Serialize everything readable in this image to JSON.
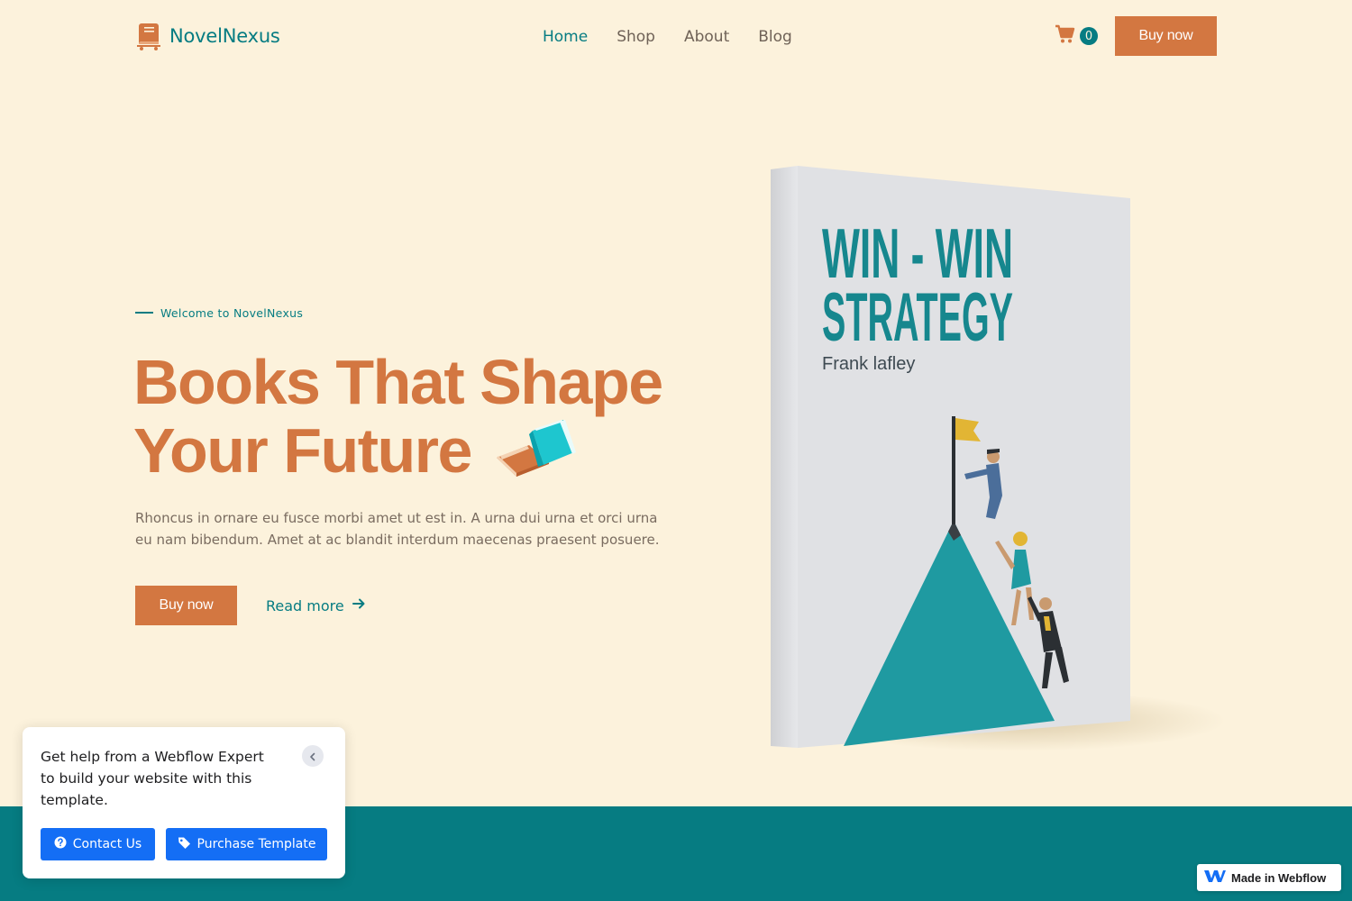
{
  "brand": {
    "name": "NovelNexus"
  },
  "nav": {
    "items": [
      {
        "label": "Home",
        "active": true
      },
      {
        "label": "Shop",
        "active": false
      },
      {
        "label": "About",
        "active": false
      },
      {
        "label": "Blog",
        "active": false
      }
    ],
    "cart_count": "0",
    "buy_label": "Buy now"
  },
  "hero": {
    "eyebrow": "Welcome to NovelNexus",
    "title_line1": "Books That Shape",
    "title_line2": "Your Future",
    "description": "Rhoncus in ornare eu fusce morbi amet ut est in. A urna dui urna et orci urna eu nam bibendum. Amet at ac blandit interdum maecenas praesent posuere.",
    "buy_label": "Buy now",
    "read_more_label": "Read more"
  },
  "book": {
    "title_line1": "WIN - WIN",
    "title_line2": "STRATEGY",
    "author": "Frank lafley"
  },
  "help_popup": {
    "text": "Get help from a Webflow Expert to build your website with this template.",
    "contact_label": "Contact Us",
    "purchase_label": "Purchase Template"
  },
  "webflow_badge": {
    "label": "Made in Webflow"
  },
  "colors": {
    "background": "#fcf2dc",
    "accent_orange": "#d37741",
    "accent_teal": "#067c82",
    "webflow_blue": "#146ef5"
  },
  "icons": [
    "book-cart-logo-icon",
    "cart-icon",
    "books-emoji-icon",
    "arrow-right-icon",
    "chevron-left-icon",
    "question-circle-icon",
    "tag-icon",
    "webflow-logo-icon"
  ]
}
